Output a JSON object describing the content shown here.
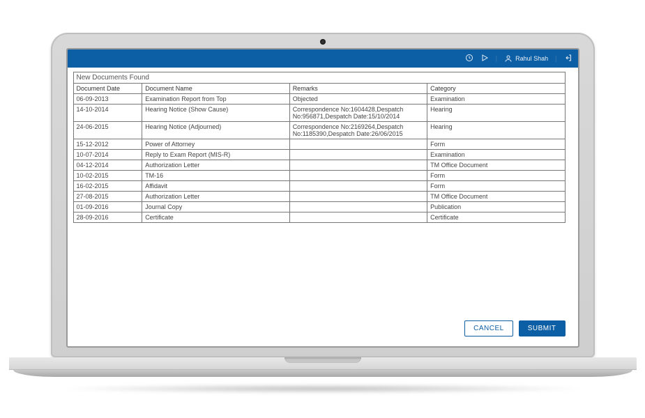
{
  "topbar": {
    "username": "Rahul Shah"
  },
  "panel": {
    "title": "New Documents Found"
  },
  "table": {
    "headers": [
      "Document Date",
      "Document Name",
      "Remarks",
      "Category"
    ],
    "rows": [
      {
        "date": "06-09-2013",
        "name": "Examination Report from Top",
        "remarks": "Objected",
        "category": "Examination"
      },
      {
        "date": "14-10-2014",
        "name": "Hearing Notice (Show Cause)",
        "remarks": "Correspondence No:1604428,Despatch No:956871,Despatch Date:15/10/2014",
        "category": "Hearing"
      },
      {
        "date": "24-06-2015",
        "name": "Hearing Notice (Adjourned)",
        "remarks": "Correspondence No:2169264,Despatch No:1185390,Despatch Date:26/06/2015",
        "category": "Hearing"
      },
      {
        "date": "15-12-2012",
        "name": "Power of Attorney",
        "remarks": "",
        "category": "Form"
      },
      {
        "date": "10-07-2014",
        "name": "Reply to Exam Report (MIS-R)",
        "remarks": "",
        "category": "Examination"
      },
      {
        "date": "04-12-2014",
        "name": "Authorization Letter",
        "remarks": "",
        "category": "TM Office Document"
      },
      {
        "date": "10-02-2015",
        "name": "TM-16",
        "remarks": "",
        "category": "Form"
      },
      {
        "date": "16-02-2015",
        "name": "Affidavit",
        "remarks": "",
        "category": "Form"
      },
      {
        "date": "27-08-2015",
        "name": "Authorization Letter",
        "remarks": "",
        "category": "TM Office Document"
      },
      {
        "date": "01-09-2016",
        "name": "Journal Copy",
        "remarks": "",
        "category": "Publication"
      },
      {
        "date": "28-09-2016",
        "name": "Certificate",
        "remarks": "",
        "category": "Certificate"
      }
    ]
  },
  "actions": {
    "cancel": "CANCEL",
    "submit": "SUBMIT"
  }
}
